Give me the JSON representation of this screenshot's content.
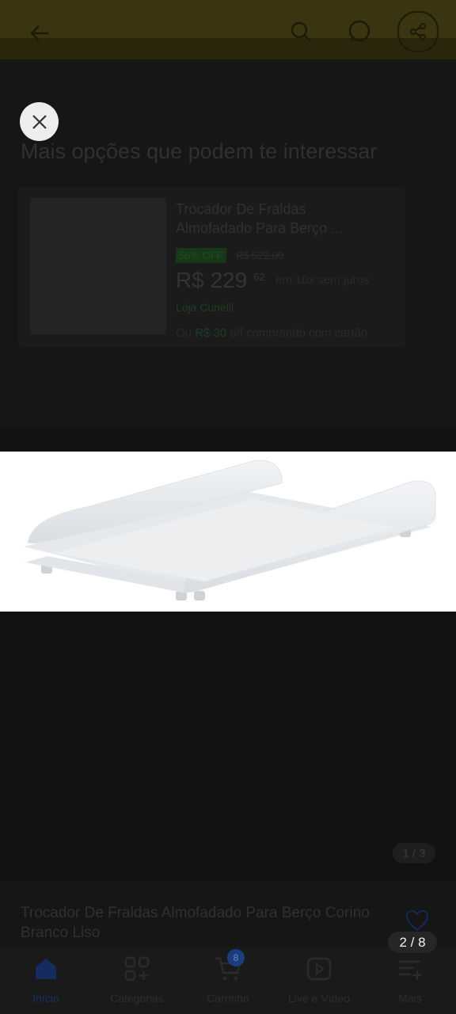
{
  "background_page": {
    "section_title": "Mais opções que podem te interessar",
    "recommendation": {
      "title": "Trocador De Fraldas Almofadado Para Berço ...",
      "discount_badge": "56% OFF",
      "old_price": "R$ 522,00",
      "price": "R$ 229",
      "price_cents": "62",
      "installments": "em 10x sem juros",
      "seller": "Loja Cunelli",
      "promo_prefix": "Ou",
      "promo_value": "R$ 30",
      "promo_suffix": "off comprando com cartão"
    },
    "photo_counter": "1 / 3",
    "product_title": "Trocador De Fraldas Almofadado Para Berço Corino Branco Liso",
    "bottom_nav": {
      "items": [
        {
          "label": "Início",
          "icon": "home-icon"
        },
        {
          "label": "Categorias",
          "icon": "categories-icon"
        },
        {
          "label": "Carrinho",
          "icon": "cart-icon"
        },
        {
          "label": "Live e Vídeo",
          "icon": "play-icon"
        },
        {
          "label": "Mais",
          "icon": "more-menu-icon"
        }
      ],
      "cart_badge": "8"
    },
    "colors": {
      "top_bar": "#FFE600",
      "active": "#3483FA"
    }
  },
  "viewer": {
    "page_indicator": "2 / 8",
    "image_description_icon": "changing-pad-product-image",
    "close_icon": "close-icon"
  }
}
